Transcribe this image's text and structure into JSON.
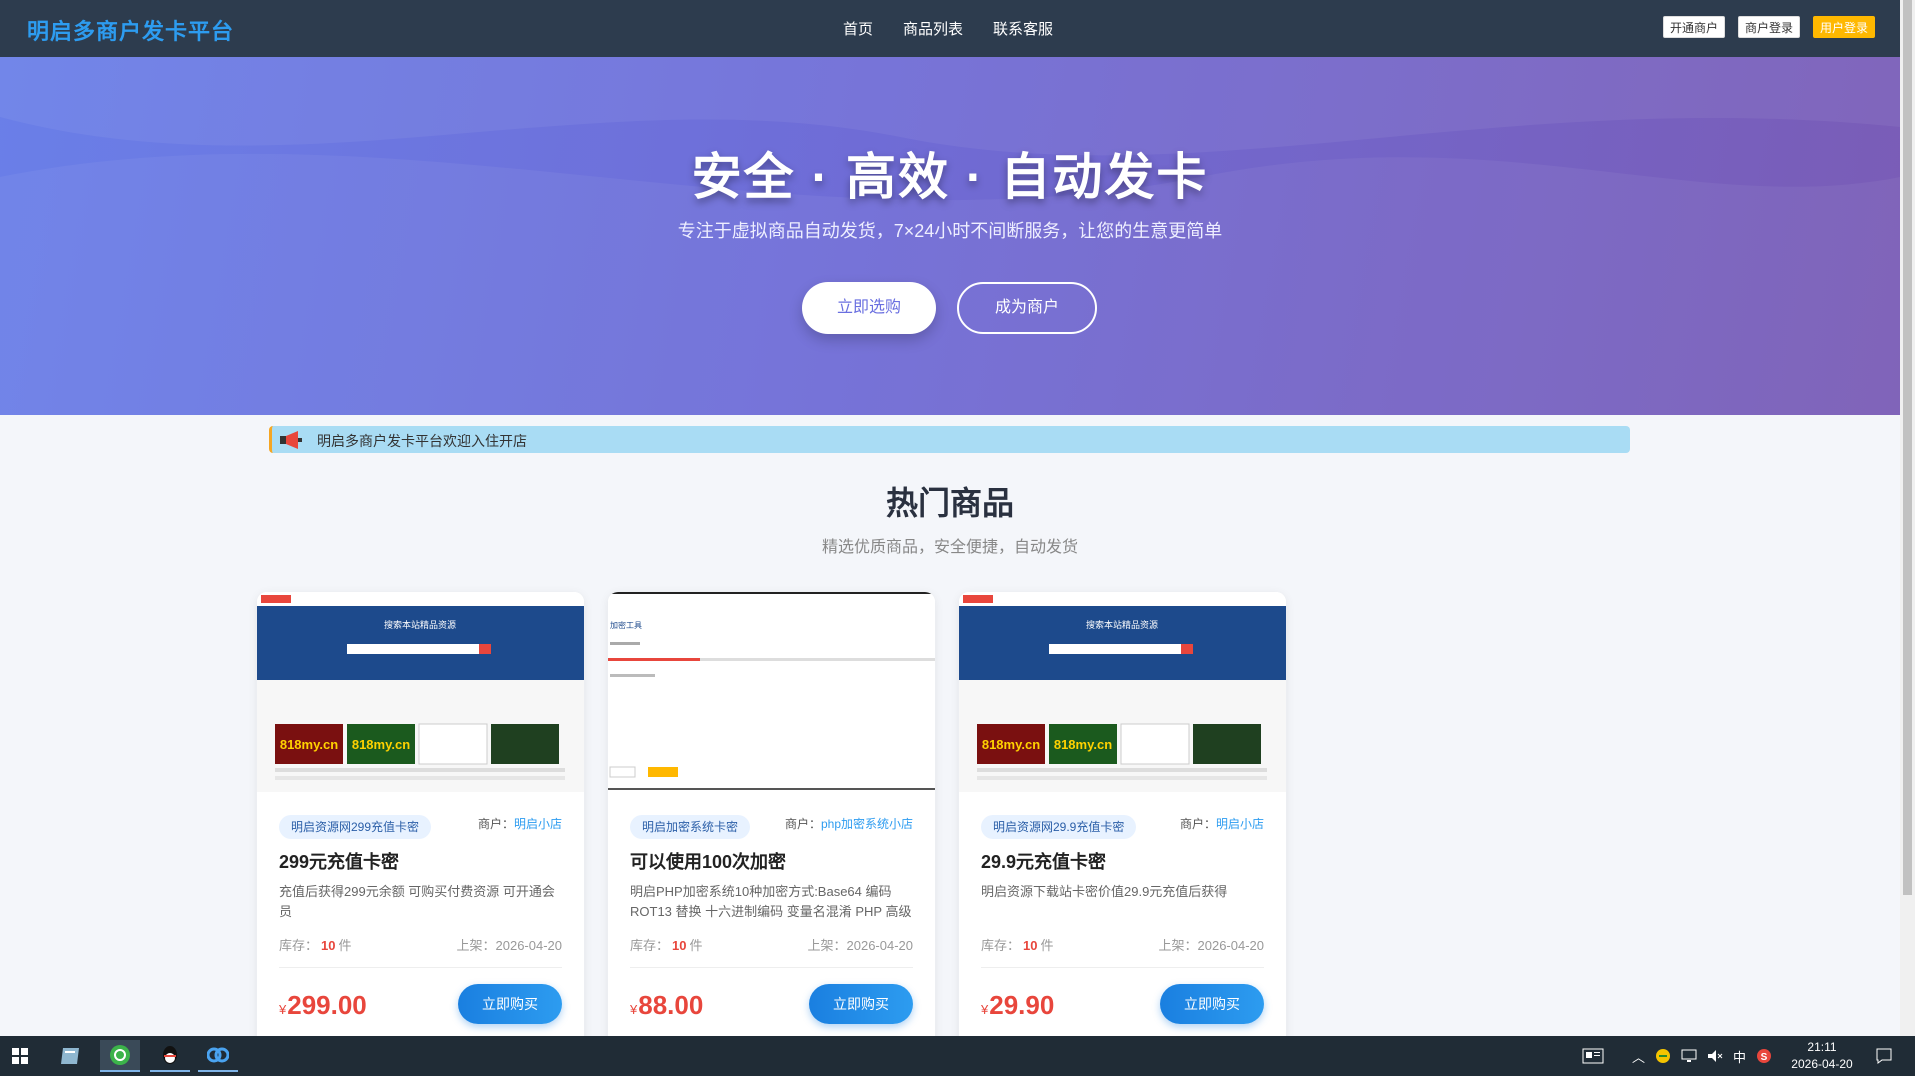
{
  "nav": {
    "brand": "明启多商户发卡平台",
    "menu": [
      "首页",
      "商品列表",
      "联系客服"
    ],
    "buttons": [
      "开通商户",
      "商户登录",
      "用户登录"
    ]
  },
  "hero": {
    "title": "安全 · 高效 · 自动发卡",
    "subtitle": "专注于虚拟商品自动发货，7×24小时不间断服务，让您的生意更简单",
    "primary_button": "立即选购",
    "secondary_button": "成为商户"
  },
  "notice": {
    "text": "明启多商户发卡平台欢迎入住开店"
  },
  "section": {
    "title": "热门商品",
    "subtitle": "精选优质商品，安全便捷，自动发货"
  },
  "products": [
    {
      "category": "明启资源网299充值卡密",
      "merchant_label": "商户：",
      "merchant": "明启小店",
      "title": "299元充值卡密",
      "description": "充值后获得299元余额 可购买付费资源 可开通会员",
      "stock_label": "库存：",
      "stock": "10",
      "stock_unit": "件",
      "date": "上架：2026-04-20",
      "currency": "¥",
      "price": "299.00",
      "buy": "立即购买"
    },
    {
      "category": "明启加密系统卡密",
      "merchant_label": "商户：",
      "merchant": "php加密系统小店",
      "title": "可以使用100次加密",
      "description": "明启PHP加密系统10种加密方式:Base64 编码 ROT13 替换 十六进制编码 变量名混淆 PHP 高级",
      "stock_label": "库存：",
      "stock": "10",
      "stock_unit": "件",
      "date": "上架：2026-04-20",
      "currency": "¥",
      "price": "88.00",
      "buy": "立即购买"
    },
    {
      "category": "明启资源网29.9充值卡密",
      "merchant_label": "商户：",
      "merchant": "明启小店",
      "title": "29.9元充值卡密",
      "description": "明启资源下载站卡密价值29.9元充值后获得",
      "stock_label": "库存：",
      "stock": "10",
      "stock_unit": "件",
      "date": "上架：2026-04-20",
      "currency": "¥",
      "price": "29.90",
      "buy": "立即购买"
    }
  ],
  "thumbnails": {
    "site_search_title": "搜索本站精品资源",
    "encrypt_tool_title": "加密工具",
    "logo_text": "818my.cn"
  },
  "taskbar": {
    "icons": [
      "windows-start-icon",
      "file-explorer-icon",
      "browser-icon",
      "qq-icon",
      "baidu-netdisk-icon"
    ],
    "ime": "中",
    "time": "21:11",
    "date": "2026-04-20"
  },
  "colors": {
    "accent": "#2d9cf0",
    "nav_bg": "#2d3c4e",
    "price_red": "#e8463c",
    "warn": "#ffb800"
  }
}
